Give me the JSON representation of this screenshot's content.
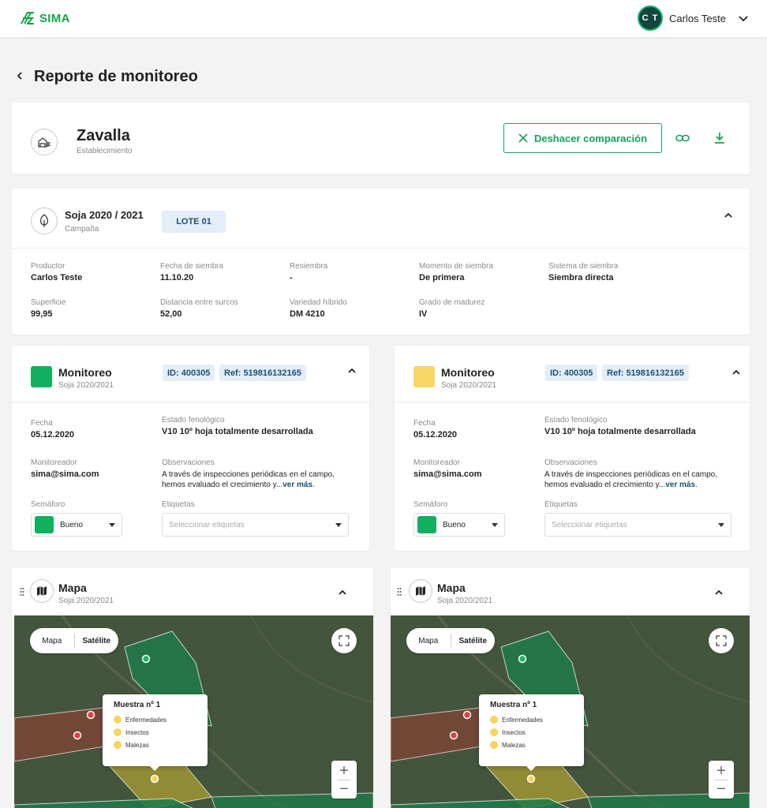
{
  "app": {
    "logo_text": "SIMA",
    "brand_color": "#17a34a"
  },
  "user": {
    "initials": "C T",
    "name": "Carlos Teste"
  },
  "page": {
    "title": "Reporte de monitoreo"
  },
  "establishment": {
    "name": "Zavalla",
    "subtitle": "Establecimiento",
    "undo_compare_label": "Deshacer comparación"
  },
  "campaign": {
    "name": "Soja 2020 / 2021",
    "subtitle": "Campaña",
    "lote": "LOTE 01",
    "fields": [
      {
        "label": "Productor",
        "value": "Carlos Teste"
      },
      {
        "label": "Fecha de siembra",
        "value": "11.10.20"
      },
      {
        "label": "Resiembra",
        "value": "-"
      },
      {
        "label": "Momento de siembra",
        "value": "De primera"
      },
      {
        "label": "Sistema de siembra",
        "value": "Siembra directa"
      },
      {
        "label": "Superficie",
        "value": "99,95"
      },
      {
        "label": "Distancia entre surcos",
        "value": "52,00"
      },
      {
        "label": "Variedad híbrido",
        "value": "DM 4210"
      },
      {
        "label": "Grado de madurez",
        "value": "IV"
      }
    ]
  },
  "monitoreos": [
    {
      "color": "#10b05f",
      "title": "Monitoreo",
      "subtitle": "Soja 2020/2021",
      "id_tag": "ID: 400305",
      "ref_tag": "Ref: 519816132165",
      "fecha_label": "Fecha",
      "fecha": "05.12.2020",
      "estado_label": "Estado fenológico",
      "estado": "V10 10º hoja totalmente desarrollada",
      "monitoreador_label": "Monitoreador",
      "monitoreador": "sima@sima.com",
      "obs_label": "Observaciones",
      "obs_line1": "A través de inspecciones periódicas en el campo,",
      "obs_line2": "hemos evaluado el crecimiento y...",
      "ver_mas": "ver más",
      "semaforo_label": "Semáforo",
      "semaforo": "Bueno",
      "etiquetas_label": "Etiquetas",
      "etiquetas_placeholder": "Seleccionar etiquetas"
    },
    {
      "color": "#f9d766",
      "title": "Monitoreo",
      "subtitle": "Soja 2020/2021",
      "id_tag": "ID: 400305",
      "ref_tag": "Ref: 519816132165",
      "fecha_label": "Fecha",
      "fecha": "05.12.2020",
      "estado_label": "Estado fenológico",
      "estado": "V10 10º hoja totalmente desarrollada",
      "monitoreador_label": "Monitoreador",
      "monitoreador": "sima@sima.com",
      "obs_label": "Observaciones",
      "obs_line1": "A través de inspecciones periódicas en el campo,",
      "obs_line2": "hemos evaluado el crecimiento y...",
      "ver_mas": "ver más",
      "semaforo_label": "Semáforo",
      "semaforo": "Bueno",
      "etiquetas_label": "Etiquetas",
      "etiquetas_placeholder": "Seleccionar etiquetas"
    }
  ],
  "maps": [
    {
      "title": "Mapa",
      "subtitle": "Soja 2020/2021",
      "toggle_map": "Mapa",
      "toggle_sat": "Satélite",
      "popup_title": "Muestra nº 1",
      "popup_items": [
        "Enfermedades",
        "Insectos",
        "Malezas"
      ],
      "zoom_in": "+",
      "zoom_out": "−"
    },
    {
      "title": "Mapa",
      "subtitle": "Soja 2020/2021",
      "toggle_map": "Mapa",
      "toggle_sat": "Satélite",
      "popup_title": "Muestra nº 1",
      "popup_items": [
        "Enfermedades",
        "Insectos",
        "Malezas"
      ],
      "zoom_in": "+",
      "zoom_out": "−"
    }
  ]
}
